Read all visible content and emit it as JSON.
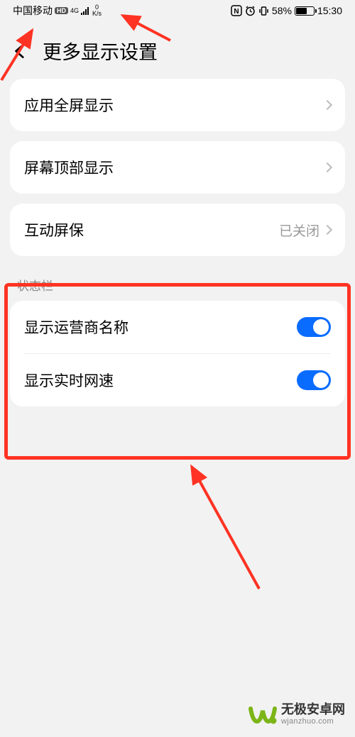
{
  "statusbar": {
    "carrier": "中国移动",
    "hd": "HD",
    "network": "4G",
    "speed_num": "0",
    "speed_unit": "K/s",
    "nfc": "N",
    "alarm": "⏰",
    "vibrate": "📳",
    "battery_pct": "58%",
    "time": "15:30"
  },
  "header": {
    "title": "更多显示设置"
  },
  "rows": {
    "fullscreen": "应用全屏显示",
    "top_display": "屏幕顶部显示",
    "screensaver_label": "互动屏保",
    "screensaver_value": "已关闭"
  },
  "section": {
    "statusbar_title": "状态栏",
    "show_carrier": "显示运营商名称",
    "show_netspeed": "显示实时网速"
  },
  "watermark": {
    "cn": "无极安卓网",
    "en": "wjanzhuo.com"
  }
}
